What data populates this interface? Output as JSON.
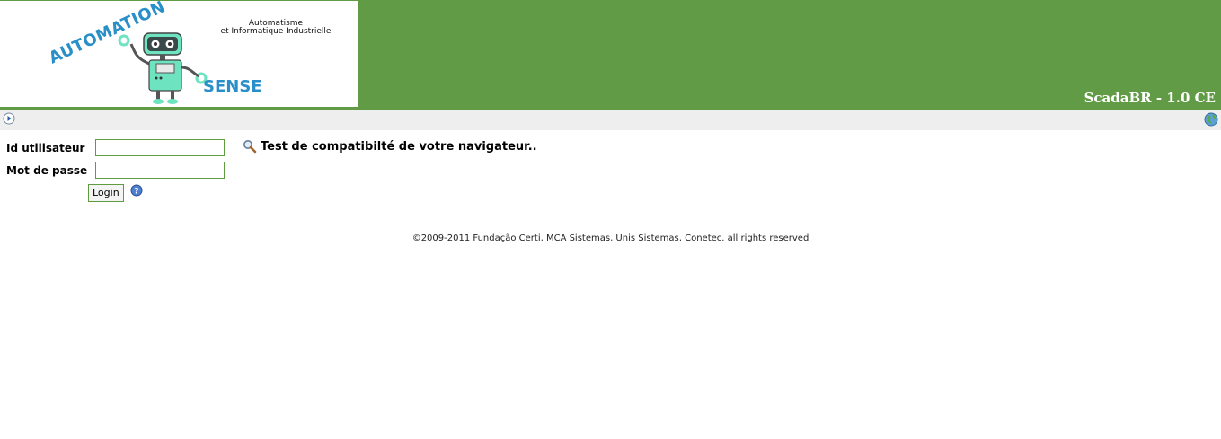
{
  "header": {
    "logo": {
      "word_top": "AUTOMATION",
      "word_bottom": "SENSE",
      "tagline_line1": "Automatisme",
      "tagline_line2": "et Informatique Industrielle"
    },
    "app_title": "ScadaBR - 1.0 CE",
    "colors": {
      "header_green": "#619b45",
      "logo_blue": "#2a8fc9",
      "robot_mint": "#6de3c0",
      "toolbar_gray": "#eeeeee",
      "input_border": "#5e9c3f"
    }
  },
  "toolbar": {
    "left_icon": "play-circle-icon",
    "right_icon": "globe-icon"
  },
  "login": {
    "username_label": "Id utilisateur",
    "username_value": "",
    "password_label": "Mot de passe",
    "password_value": "",
    "login_button": "Login",
    "help_icon": "help-icon"
  },
  "compat": {
    "icon": "magnifier-icon",
    "text": "Test de compatibilté de votre navigateur.."
  },
  "footer": {
    "copyright": "©2009-2011 Fundação Certi, MCA Sistemas, Unis Sistemas, Conetec. all rights reserved"
  }
}
